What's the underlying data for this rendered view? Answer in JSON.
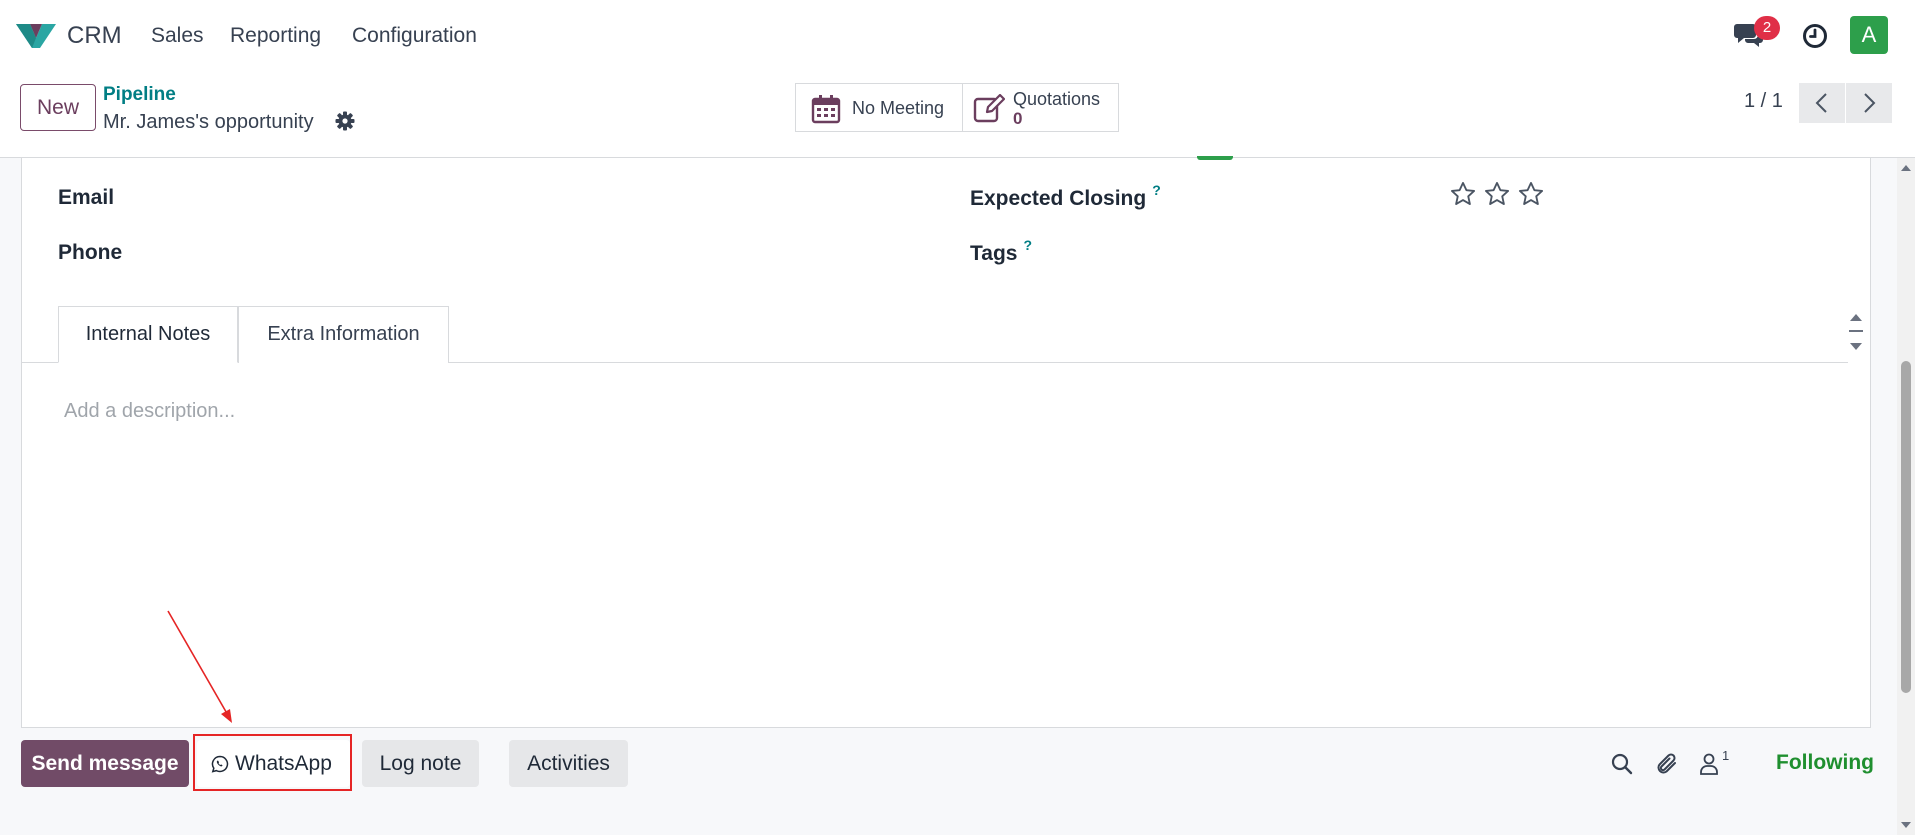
{
  "navbar": {
    "app_name": "CRM",
    "menu": [
      "Sales",
      "Reporting",
      "Configuration"
    ],
    "messages_badge": "2",
    "user_initial": "A",
    "icons": {
      "messages": "chat-bubbles-icon",
      "activities": "clock-icon"
    }
  },
  "control_panel": {
    "new_label": "New",
    "breadcrumb": "Pipeline",
    "record_title": "Mr. James's opportunity",
    "smart_buttons": {
      "meeting_label": "No Meeting",
      "quotations_label": "Quotations",
      "quotations_count": "0"
    },
    "pager": "1 / 1"
  },
  "form": {
    "fields": {
      "email_label": "Email",
      "phone_label": "Phone",
      "expected_closing_label": "Expected Closing",
      "tags_label": "Tags",
      "help_mark": "?"
    },
    "priority_stars": 0,
    "tabs": [
      "Internal Notes",
      "Extra Information"
    ],
    "active_tab": "Internal Notes",
    "description_placeholder": "Add a description..."
  },
  "chatter": {
    "send_message": "Send message",
    "whatsapp": "WhatsApp",
    "log_note": "Log note",
    "activities": "Activities",
    "follower_count": "1",
    "following": "Following"
  },
  "colors": {
    "brand_purple": "#714b67",
    "teal_link": "#017e84",
    "following_green": "#1f8f2f",
    "highlight_red": "#e52525"
  }
}
